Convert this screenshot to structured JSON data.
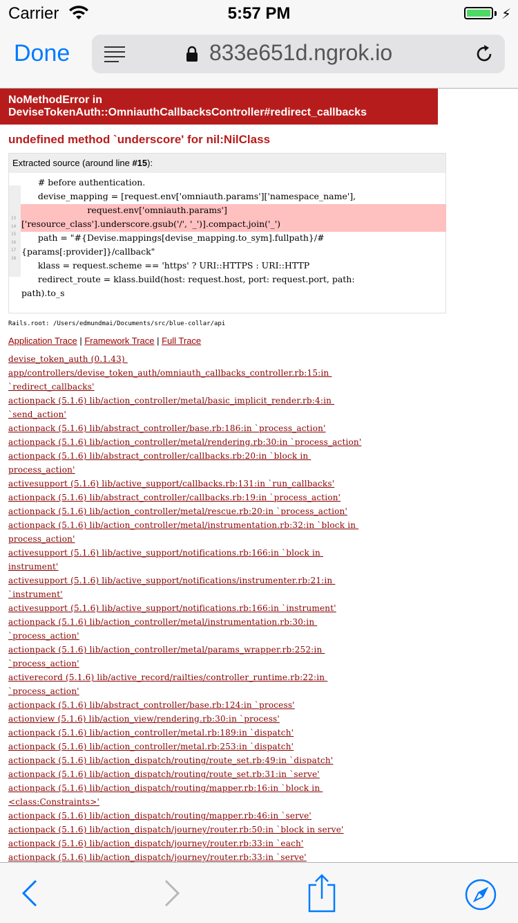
{
  "status_bar": {
    "carrier": "Carrier",
    "time": "5:57 PM",
    "battery_color": "#4cd964"
  },
  "nav": {
    "done_label": "Done",
    "url": "833e651d.ngrok.io",
    "accent_color": "#007aff",
    "icons": [
      "reader-icon",
      "lock-icon",
      "reload-icon"
    ]
  },
  "error": {
    "title_line1": "NoMethodError in",
    "title_line2": "DeviseTokenAuth::OmniauthCallbacksController#redirect_callbacks",
    "message": "undefined method `underscore' for nil:NilClass",
    "header_color": "#b71c1c"
  },
  "source": {
    "header_prefix": "Extracted source (around line ",
    "header_line": "#15",
    "header_suffix": "):",
    "gutter": [
      "13",
      "14",
      "15",
      "16",
      "17",
      "18"
    ],
    "lines": [
      "      # before authentication.",
      "      devise_mapping = [request.env['omniauth.params']['namespace_name'],",
      "                        request.env['omniauth.params']",
      "['resource_class'].underscore.gsub('/', '_')].compact.join('_')",
      "      path = \"#{Devise.mappings[devise_mapping.to_sym].fullpath}/#",
      "{params[:provider]}/callback\"",
      "      klass = request.scheme == 'https' ? URI::HTTPS : URI::HTTP",
      "      redirect_route = klass.build(host: request.host, port: request.port, path:",
      "path).to_s"
    ]
  },
  "rails_root": "Rails.root: /Users/edmundmai/Documents/src/blue-collar/api",
  "trace_links": {
    "application": "Application Trace",
    "framework": "Framework Trace",
    "full": "Full Trace",
    "separator": " | "
  },
  "trace": [
    "devise_token_auth (0.1.43) ",
    "app/controllers/devise_token_auth/omniauth_callbacks_controller.rb:15:in ",
    "`redirect_callbacks'",
    "actionpack (5.1.6) lib/action_controller/metal/basic_implicit_render.rb:4:in ",
    "`send_action'",
    "actionpack (5.1.6) lib/abstract_controller/base.rb:186:in `process_action'",
    "actionpack (5.1.6) lib/action_controller/metal/rendering.rb:30:in `process_action'",
    "actionpack (5.1.6) lib/abstract_controller/callbacks.rb:20:in `block in ",
    "process_action'",
    "activesupport (5.1.6) lib/active_support/callbacks.rb:131:in `run_callbacks'",
    "actionpack (5.1.6) lib/abstract_controller/callbacks.rb:19:in `process_action'",
    "actionpack (5.1.6) lib/action_controller/metal/rescue.rb:20:in `process_action'",
    "actionpack (5.1.6) lib/action_controller/metal/instrumentation.rb:32:in `block in ",
    "process_action'",
    "activesupport (5.1.6) lib/active_support/notifications.rb:166:in `block in ",
    "instrument'",
    "activesupport (5.1.6) lib/active_support/notifications/instrumenter.rb:21:in ",
    "`instrument'",
    "activesupport (5.1.6) lib/active_support/notifications.rb:166:in `instrument'",
    "actionpack (5.1.6) lib/action_controller/metal/instrumentation.rb:30:in ",
    "`process_action'",
    "actionpack (5.1.6) lib/action_controller/metal/params_wrapper.rb:252:in ",
    "`process_action'",
    "activerecord (5.1.6) lib/active_record/railties/controller_runtime.rb:22:in ",
    "`process_action'",
    "actionpack (5.1.6) lib/abstract_controller/base.rb:124:in `process'",
    "actionview (5.1.6) lib/action_view/rendering.rb:30:in `process'",
    "actionpack (5.1.6) lib/action_controller/metal.rb:189:in `dispatch'",
    "actionpack (5.1.6) lib/action_controller/metal.rb:253:in `dispatch'",
    "actionpack (5.1.6) lib/action_dispatch/routing/route_set.rb:49:in `dispatch'",
    "actionpack (5.1.6) lib/action_dispatch/routing/route_set.rb:31:in `serve'",
    "actionpack (5.1.6) lib/action_dispatch/routing/mapper.rb:16:in `block in ",
    "<class:Constraints>'",
    "actionpack (5.1.6) lib/action_dispatch/routing/mapper.rb:46:in `serve'",
    "actionpack (5.1.6) lib/action_dispatch/journey/router.rb:50:in `block in serve'",
    "actionpack (5.1.6) lib/action_dispatch/journey/router.rb:33:in `each'",
    "actionpack (5.1.6) lib/action_dispatch/journey/router.rb:33:in `serve'"
  ],
  "toolbar": {
    "icons": [
      "back-icon",
      "forward-icon",
      "share-icon",
      "safari-compass-icon"
    ]
  }
}
